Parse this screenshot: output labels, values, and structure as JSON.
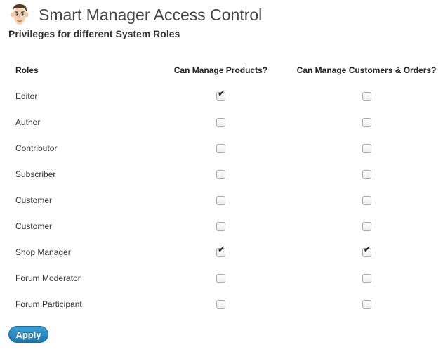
{
  "header": {
    "title": "Smart Manager Access Control",
    "subtitle": "Privileges for different System Roles",
    "avatar_icon": "cartoon-face-avatar"
  },
  "table": {
    "columns": [
      "Roles",
      "Can Manage Products?",
      "Can Manage Customers & Orders?"
    ],
    "rows": [
      {
        "role": "Editor",
        "products": true,
        "customers": false
      },
      {
        "role": "Author",
        "products": false,
        "customers": false
      },
      {
        "role": "Contributor",
        "products": false,
        "customers": false
      },
      {
        "role": "Subscriber",
        "products": false,
        "customers": false
      },
      {
        "role": "Customer",
        "products": false,
        "customers": false
      },
      {
        "role": "Customer",
        "products": false,
        "customers": false
      },
      {
        "role": "Shop Manager",
        "products": true,
        "customers": true
      },
      {
        "role": "Forum Moderator",
        "products": false,
        "customers": false
      },
      {
        "role": "Forum Participant",
        "products": false,
        "customers": false
      }
    ]
  },
  "actions": {
    "apply_label": "Apply"
  },
  "colors": {
    "accent": "#2a8bc4",
    "title": "#464646"
  }
}
